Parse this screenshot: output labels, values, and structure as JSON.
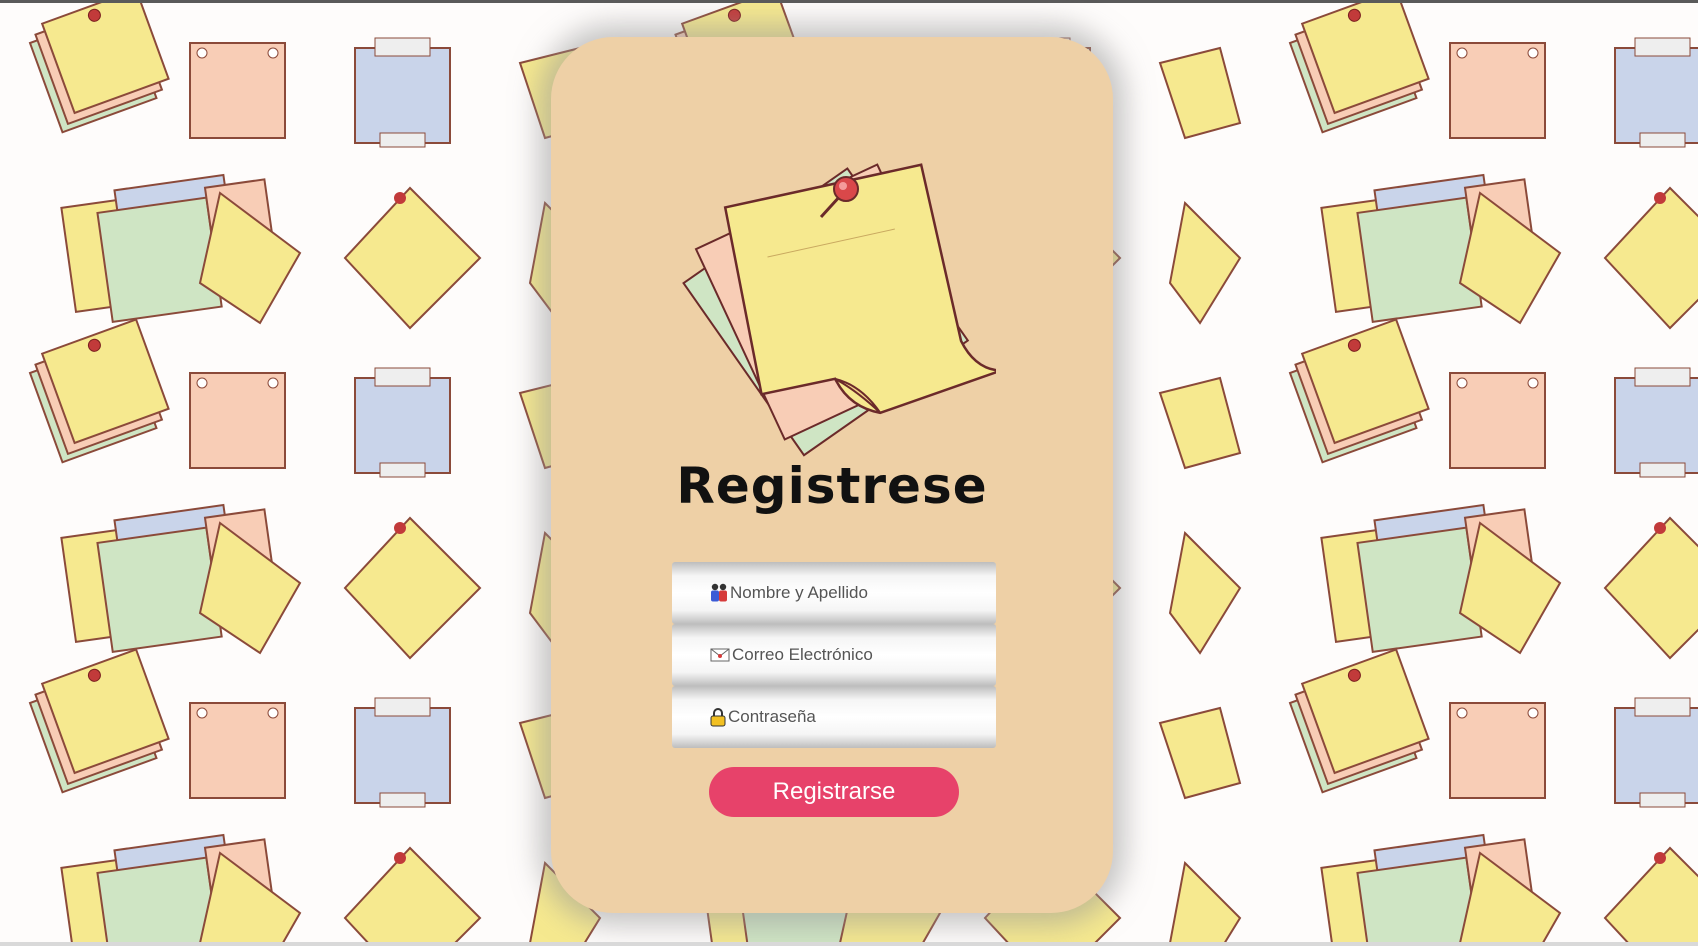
{
  "form": {
    "title": "Registrese",
    "fields": [
      {
        "placeholder": "Nombre y Apellido",
        "icon": "people-icon"
      },
      {
        "placeholder": "Correo Electrónico",
        "icon": "envelope-icon"
      },
      {
        "placeholder": "Contraseña",
        "icon": "lock-icon"
      }
    ],
    "submit_label": "Registrarse"
  },
  "colors": {
    "card_background": "#eed0a6",
    "submit_background": "#e7426a",
    "note_yellow": "#f6e98f",
    "note_pink": "#f8cdb6",
    "note_blue": "#c9d4ea",
    "note_green": "#cfe5c4"
  }
}
